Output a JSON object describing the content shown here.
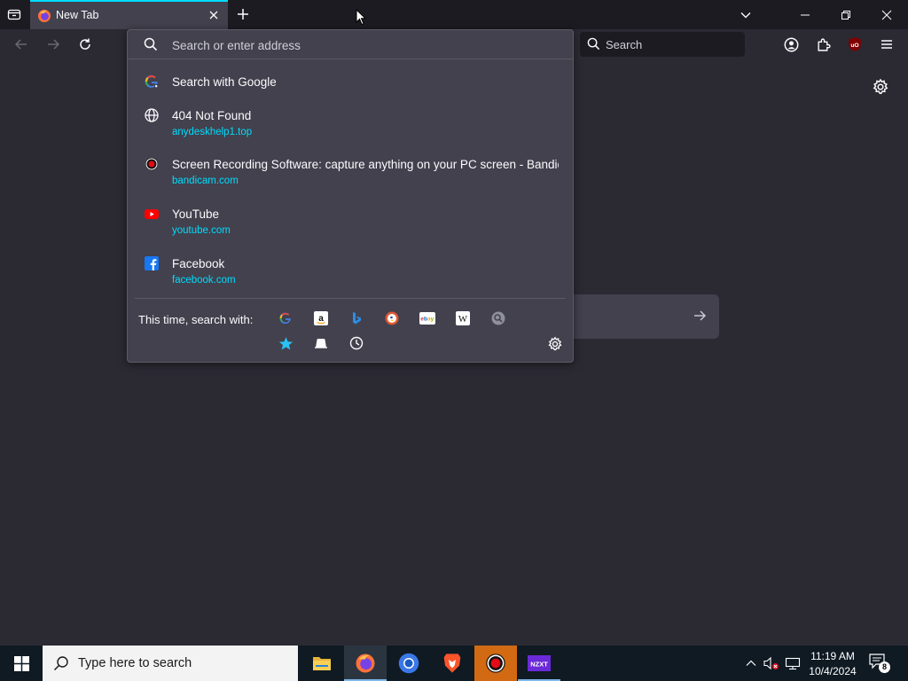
{
  "browser": {
    "tab": {
      "title": "New Tab"
    },
    "toolbar": {
      "search_placeholder": "Search"
    }
  },
  "urlbar": {
    "placeholder": "Search or enter address",
    "results": [
      {
        "icon": "google-icon",
        "title": "Search with Google",
        "url": ""
      },
      {
        "icon": "globe-icon",
        "title": "404 Not Found",
        "url": "anydeskhelp1.top"
      },
      {
        "icon": "record-icon",
        "title": "Screen Recording Software: capture anything on your PC screen - Bandicam",
        "url": "bandicam.com"
      },
      {
        "icon": "youtube-icon",
        "title": "YouTube",
        "url": "youtube.com"
      },
      {
        "icon": "facebook-icon",
        "title": "Facebook",
        "url": "facebook.com"
      }
    ],
    "one_off_label": "This time, search with:",
    "engines": [
      "google-icon",
      "amazon-icon",
      "bing-icon",
      "duckduckgo-icon",
      "ebay-icon",
      "wikipedia-icon",
      "search-engine-icon",
      "bookmarks-star-icon",
      "tabs-icon",
      "history-icon"
    ]
  },
  "taskbar": {
    "search_placeholder": "Type here to search",
    "time": "11:19 AM",
    "date": "10/4/2024",
    "notification_count": "8"
  },
  "colors": {
    "accent": "#00ddff",
    "panel": "#42414d",
    "toolbar": "#2b2a33",
    "tabstrip": "#1c1b22"
  }
}
